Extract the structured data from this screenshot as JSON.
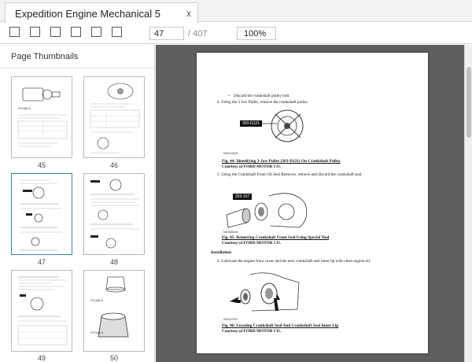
{
  "tab": {
    "title": "Expedition Engine Mechanical 5",
    "close": "x"
  },
  "toolbar": {
    "buttons": [
      "tool-button-1",
      "tool-button-2",
      "tool-button-3",
      "tool-button-4",
      "tool-button-5",
      "tool-button-6"
    ],
    "page_value": "47",
    "page_total": "/ 407",
    "zoom_value": "100%"
  },
  "sidebar": {
    "title": "Page Thumbnails",
    "thumbnails": [
      {
        "page": "45",
        "selected": false
      },
      {
        "page": "46",
        "selected": false
      },
      {
        "page": "47",
        "selected": true
      },
      {
        "page": "48",
        "selected": false
      },
      {
        "page": "49",
        "selected": false
      },
      {
        "page": "50",
        "selected": false
      }
    ],
    "thumb_codes": {
      "t45": "ST1285-A",
      "t50a": "ST1186-A",
      "t50b": "ST2161-A"
    }
  },
  "document": {
    "bullet": "Discard the crankshaft pulley bolt.",
    "step4": "4.  Using the 3 Jaw Puller, remove the crankshaft pulley.",
    "tool_tag_1": "303-D121",
    "fig44_id": "N0010026",
    "fig44_title": "Fig. 44: Identifying 3-Jaw Puller (303-D121) On Crankshaft Pulley",
    "fig44_credit": "Courtesy of FORD MOTOR CO.",
    "step5": "5.  Using the Crankshaft Front Oil Seal Remover, remove and discard the crankshaft seal.",
    "tool_tag_2": "303-107",
    "fig45_id": "N0058156",
    "fig45_title": "Fig. 45: Removing Crankshaft Front Seal Using Special Tool",
    "fig45_credit": "Courtesy of FORD MOTOR CO.",
    "section": "Installation",
    "step1": "1.  Lubricate the engine front cover and the new crankshaft seal inner lip with clean engine oil.",
    "fig46_id": "A0029787",
    "fig46_title": "Fig. 46: Locating Crankshaft Seal And Crankshaft Seal Inner Lip",
    "fig46_credit": "Courtesy of FORD MOTOR CO."
  },
  "colors": {
    "viewer_bg": "#5f5f5f",
    "selection": "#3b82c4"
  }
}
